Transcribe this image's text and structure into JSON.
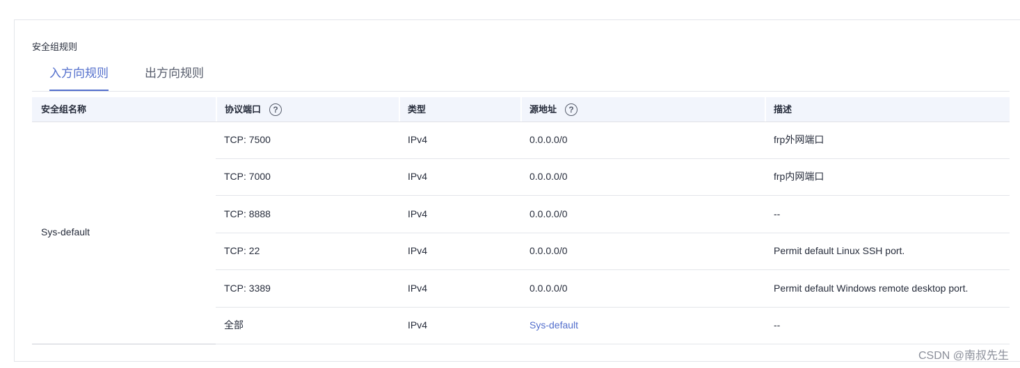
{
  "section_title": "安全组规则",
  "tabs": [
    {
      "label": "入方向规则",
      "active": true
    },
    {
      "label": "出方向规则",
      "active": false
    }
  ],
  "table": {
    "columns": [
      "安全组名称",
      "协议端口",
      "类型",
      "源地址",
      "描述"
    ],
    "group_name": "Sys-default",
    "rows": [
      {
        "port": "TCP: 7500",
        "type": "IPv4",
        "source": "0.0.0.0/0",
        "description": "frp外网端口"
      },
      {
        "port": "TCP: 7000",
        "type": "IPv4",
        "source": "0.0.0.0/0",
        "description": "frp内网端口"
      },
      {
        "port": "TCP: 8888",
        "type": "IPv4",
        "source": "0.0.0.0/0",
        "description": "--"
      },
      {
        "port": "TCP: 22",
        "type": "IPv4",
        "source": "0.0.0.0/0",
        "description": "Permit default Linux SSH port."
      },
      {
        "port": "TCP: 3389",
        "type": "IPv4",
        "source": "0.0.0.0/0",
        "description": "Permit default Windows remote desktop port."
      },
      {
        "port": "全部",
        "type": "IPv4",
        "source": "Sys-default",
        "description": "--"
      }
    ]
  },
  "help_icon_glyph": "?",
  "watermark": "CSDN @南叔先生",
  "colors": {
    "accent": "#526ecc",
    "header_bg": "#f2f5fc",
    "text": "#252b3a"
  }
}
